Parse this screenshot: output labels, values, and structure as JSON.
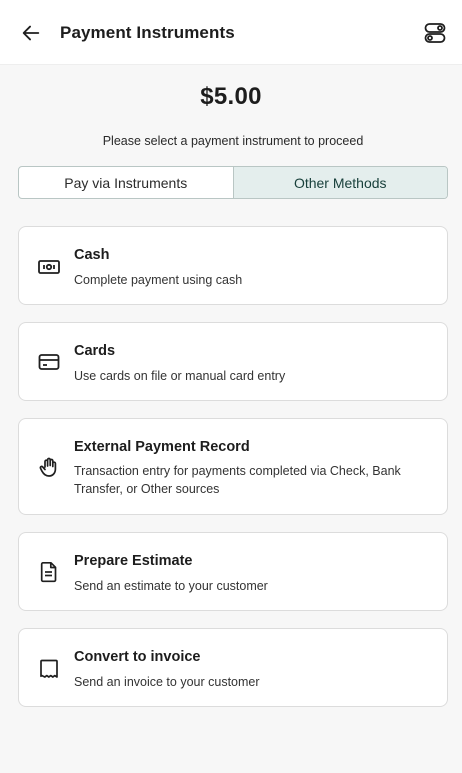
{
  "header": {
    "title": "Payment Instruments",
    "back_icon": "arrow-left-icon",
    "toggle_icon": "toggles-icon"
  },
  "payment": {
    "amount": "$5.00",
    "instruction": "Please select a payment instrument to proceed"
  },
  "tabs": [
    {
      "label": "Pay via Instruments",
      "active": false
    },
    {
      "label": "Other Methods",
      "active": true
    }
  ],
  "methods": [
    {
      "title": "Cash",
      "description": "Complete payment using cash",
      "icon": "cash-icon"
    },
    {
      "title": "Cards",
      "description": "Use cards on file or manual card entry",
      "icon": "credit-card-icon"
    },
    {
      "title": "External Payment Record",
      "description": "Transaction entry for payments completed via Check, Bank Transfer, or Other sources",
      "icon": "hand-icon"
    },
    {
      "title": "Prepare Estimate",
      "description": "Send an estimate to your customer",
      "icon": "document-icon"
    },
    {
      "title": "Convert to invoice",
      "description": "Send an invoice to your customer",
      "icon": "receipt-icon"
    }
  ],
  "colors": {
    "accent_bg": "#e4eeed",
    "accent_text": "#173f3a",
    "background": "#f7f7f7"
  }
}
